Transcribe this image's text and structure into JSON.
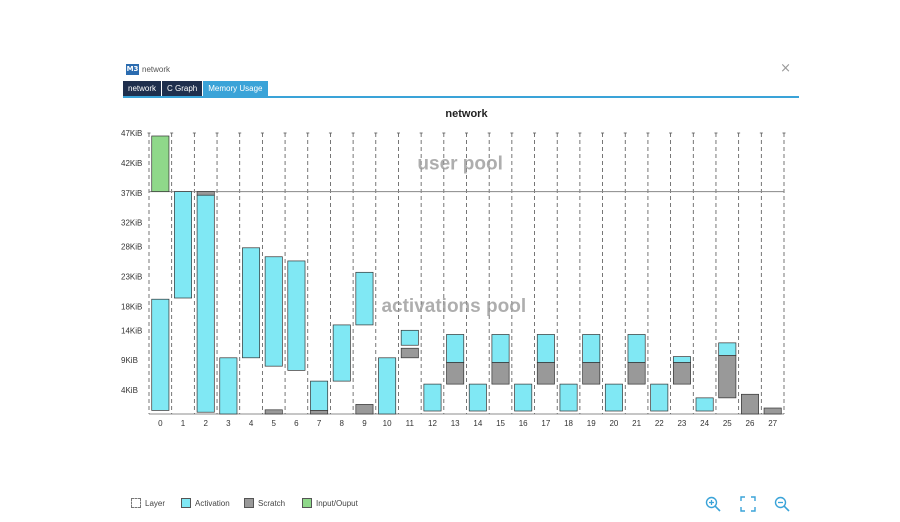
{
  "window": {
    "icon_text": "M3",
    "title": "network",
    "close_glyph": "×"
  },
  "tabs": [
    {
      "label": "network",
      "active": false
    },
    {
      "label": "C Graph",
      "active": false
    },
    {
      "label": "Memory Usage",
      "active": true
    }
  ],
  "colors": {
    "activation": "#80e8f4",
    "scratch": "#999999",
    "io": "#8fd88a",
    "tab_active": "#3aa3d8",
    "tab_inactive": "#1f2f4d",
    "zoom_icons": "#3aa3d8"
  },
  "legend": [
    {
      "label": "Layer",
      "kind": "layer"
    },
    {
      "label": "Activation",
      "kind": "activation"
    },
    {
      "label": "Scratch",
      "kind": "scratch"
    },
    {
      "label": "Input/Ouput",
      "kind": "io"
    }
  ],
  "toolbar": {
    "zoom_in_icon": "zoom-in-icon",
    "fit_icon": "fit-screen-icon",
    "zoom_out_icon": "zoom-out-icon"
  },
  "chart_data": {
    "type": "bar",
    "title": "network",
    "y_unit": "KiB",
    "ylim": [
      0,
      47
    ],
    "y_ticks": [
      {
        "value": 4,
        "label": "4KiB"
      },
      {
        "value": 9,
        "label": "9KiB"
      },
      {
        "value": 14,
        "label": "14KiB"
      },
      {
        "value": 18,
        "label": "18KiB"
      },
      {
        "value": 23,
        "label": "23KiB"
      },
      {
        "value": 28,
        "label": "28KiB"
      },
      {
        "value": 32,
        "label": "32KiB"
      },
      {
        "value": 37,
        "label": "37KiB"
      },
      {
        "value": 42,
        "label": "42KiB"
      },
      {
        "value": 47,
        "label": "47KiB"
      }
    ],
    "layers": [
      "0",
      "1",
      "2",
      "3",
      "4",
      "5",
      "6",
      "7",
      "8",
      "9",
      "10",
      "11",
      "12",
      "13",
      "14",
      "15",
      "16",
      "17",
      "18",
      "19",
      "20",
      "21",
      "22",
      "23",
      "24",
      "25",
      "26",
      "27"
    ],
    "pools": [
      {
        "name": "user pool",
        "from": 37.2,
        "to": 47
      },
      {
        "name": "activations pool",
        "from": 0,
        "to": 37.2
      }
    ],
    "pool_separator": 37.2,
    "series": [
      {
        "name": "Input/Ouput",
        "kind": "io",
        "blocks": [
          {
            "start": 0,
            "end": 1,
            "from": 37.2,
            "to": 46.5
          }
        ]
      },
      {
        "name": "Activation",
        "kind": "activation",
        "blocks": [
          {
            "start": 0,
            "end": 1,
            "from": 0.6,
            "to": 19.2
          },
          {
            "start": 1,
            "end": 2,
            "from": 19.4,
            "to": 37.2
          },
          {
            "start": 2,
            "end": 3,
            "from": 0.3,
            "to": 36.6
          },
          {
            "start": 3,
            "end": 4,
            "from": 0,
            "to": 9.4
          },
          {
            "start": 4,
            "end": 5,
            "from": 9.4,
            "to": 27.8
          },
          {
            "start": 5,
            "end": 6,
            "from": 8.0,
            "to": 26.3
          },
          {
            "start": 6,
            "end": 7,
            "from": 7.3,
            "to": 25.6
          },
          {
            "start": 7,
            "end": 8,
            "from": 0.6,
            "to": 5.5
          },
          {
            "start": 8,
            "end": 9,
            "from": 5.5,
            "to": 14.9
          },
          {
            "start": 9,
            "end": 10,
            "from": 14.9,
            "to": 23.7
          },
          {
            "start": 10,
            "end": 11,
            "from": 0,
            "to": 9.4
          },
          {
            "start": 11,
            "end": 12,
            "from": 11.5,
            "to": 14.0
          },
          {
            "start": 12,
            "end": 13,
            "from": 0.5,
            "to": 5.0
          },
          {
            "start": 13,
            "end": 14,
            "from": 8.6,
            "to": 13.3
          },
          {
            "start": 14,
            "end": 15,
            "from": 0.5,
            "to": 5.0
          },
          {
            "start": 15,
            "end": 16,
            "from": 8.6,
            "to": 13.3
          },
          {
            "start": 16,
            "end": 17,
            "from": 0.5,
            "to": 5.0
          },
          {
            "start": 17,
            "end": 18,
            "from": 8.6,
            "to": 13.3
          },
          {
            "start": 18,
            "end": 19,
            "from": 0.5,
            "to": 5.0
          },
          {
            "start": 19,
            "end": 20,
            "from": 8.6,
            "to": 13.3
          },
          {
            "start": 20,
            "end": 21,
            "from": 0.5,
            "to": 5.0
          },
          {
            "start": 21,
            "end": 22,
            "from": 8.6,
            "to": 13.3
          },
          {
            "start": 22,
            "end": 23,
            "from": 0.5,
            "to": 5.0
          },
          {
            "start": 23,
            "end": 24,
            "from": 8.6,
            "to": 9.6
          },
          {
            "start": 24,
            "end": 25,
            "from": 0.5,
            "to": 2.7
          },
          {
            "start": 25,
            "end": 26,
            "from": 9.8,
            "to": 11.9
          }
        ]
      },
      {
        "name": "Scratch",
        "kind": "scratch",
        "blocks": [
          {
            "start": 2,
            "end": 3,
            "from": 36.6,
            "to": 37.2
          },
          {
            "start": 5,
            "end": 6,
            "from": 0,
            "to": 0.7
          },
          {
            "start": 7,
            "end": 8,
            "from": 0,
            "to": 0.6
          },
          {
            "start": 9,
            "end": 10,
            "from": 0,
            "to": 1.6
          },
          {
            "start": 11,
            "end": 12,
            "from": 9.4,
            "to": 11.0
          },
          {
            "start": 13,
            "end": 14,
            "from": 5.0,
            "to": 8.6
          },
          {
            "start": 15,
            "end": 16,
            "from": 5.0,
            "to": 8.6
          },
          {
            "start": 17,
            "end": 18,
            "from": 5.0,
            "to": 8.6
          },
          {
            "start": 19,
            "end": 20,
            "from": 5.0,
            "to": 8.6
          },
          {
            "start": 21,
            "end": 22,
            "from": 5.0,
            "to": 8.6
          },
          {
            "start": 23,
            "end": 24,
            "from": 5.0,
            "to": 8.6
          },
          {
            "start": 25,
            "end": 26,
            "from": 2.7,
            "to": 9.8
          },
          {
            "start": 26,
            "end": 27,
            "from": 0,
            "to": 3.3
          },
          {
            "start": 27,
            "end": 28,
            "from": 0,
            "to": 1.0
          }
        ]
      }
    ],
    "grid": true,
    "legend_position": "bottom-left"
  }
}
